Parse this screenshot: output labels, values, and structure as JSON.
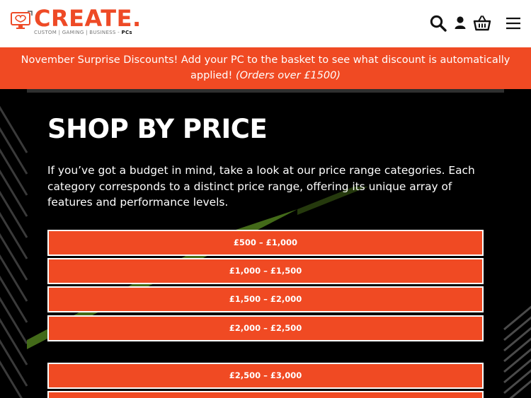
{
  "header": {
    "logo_word": "CREATE.",
    "logo_tagline": "CUSTOM | GAMING | BUSINESS - ",
    "logo_tagline_bold": "PCs",
    "icons": [
      "search-icon",
      "user-icon",
      "basket-icon",
      "menu-icon"
    ]
  },
  "promo": {
    "text": "November Surprise Discounts! Add your PC to the basket to see what discount is automatically applied!",
    "note": "(Orders over £1500)"
  },
  "main": {
    "heading": "SHOP BY PRICE",
    "intro": "If you’ve got a budget in mind, take a look at our price range categories. Each category corresponds to a distinct price range, offering its unique array of features and performance levels.",
    "price_ranges": [
      {
        "label": "£500 – £1,000"
      },
      {
        "label": "£1,000 – £1,500"
      },
      {
        "label": "£1,500 – £2,000"
      },
      {
        "label": "£2,000 – £2,500"
      },
      {
        "label": "£2,500 – £3,000"
      }
    ]
  },
  "colors": {
    "brand_orange": "#f04a23",
    "background": "#000000",
    "accent_green": "#6aa321"
  }
}
